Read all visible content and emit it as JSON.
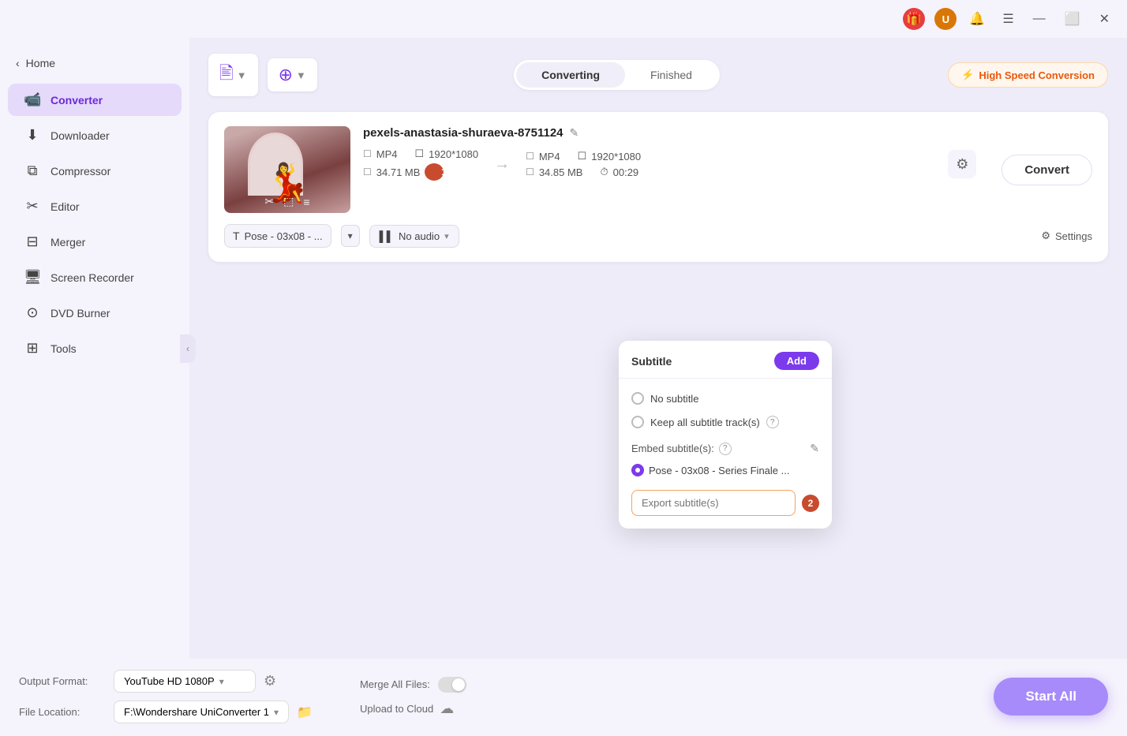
{
  "titlebar": {
    "gift_label": "🎁",
    "user_label": "U",
    "bell_label": "🔔",
    "menu_label": "☰",
    "minimize_label": "—",
    "maximize_label": "⬜",
    "close_label": "✕"
  },
  "sidebar": {
    "home_label": "Home",
    "back_label": "‹",
    "items": [
      {
        "id": "converter",
        "label": "Converter",
        "icon": "⊞"
      },
      {
        "id": "downloader",
        "label": "Downloader",
        "icon": "⬇"
      },
      {
        "id": "compressor",
        "label": "Compressor",
        "icon": "⧉"
      },
      {
        "id": "editor",
        "label": "Editor",
        "icon": "✂"
      },
      {
        "id": "merger",
        "label": "Merger",
        "icon": "⊟"
      },
      {
        "id": "screen-recorder",
        "label": "Screen Recorder",
        "icon": "⊡"
      },
      {
        "id": "dvd-burner",
        "label": "DVD Burner",
        "icon": "⊙"
      },
      {
        "id": "tools",
        "label": "Tools",
        "icon": "⊞"
      }
    ]
  },
  "tabs": {
    "converting": "Converting",
    "finished": "Finished"
  },
  "high_speed": {
    "icon": "⚡",
    "label": "High Speed Conversion"
  },
  "file": {
    "name": "pexels-anastasia-shuraeva-8751124",
    "input": {
      "format": "MP4",
      "resolution": "1920*1080",
      "size": "34.71 MB",
      "badge": "1"
    },
    "output": {
      "format": "MP4",
      "resolution": "1920*1080",
      "size": "34.85 MB",
      "duration": "00:29"
    },
    "convert_label": "Convert"
  },
  "subtitle_bar": {
    "subtitle_text": "Pose - 03x08 - ...",
    "audio_text": "No audio",
    "settings_label": "Settings"
  },
  "dropdown": {
    "title": "Subtitle",
    "add_label": "Add",
    "options": [
      {
        "id": "no-subtitle",
        "label": "No subtitle",
        "checked": false
      },
      {
        "id": "keep-all",
        "label": "Keep all subtitle track(s)",
        "checked": false
      }
    ],
    "embed_section_label": "Embed subtitle(s):",
    "embed_item": "Pose - 03x08 - Series Finale ...",
    "export_placeholder": "Export subtitle(s)",
    "export_badge": "2"
  },
  "bottom": {
    "output_format_label": "Output Format:",
    "output_format_value": "YouTube HD 1080P",
    "file_location_label": "File Location:",
    "file_location_value": "F:\\Wondershare UniConverter 1",
    "merge_label": "Merge All Files:",
    "upload_label": "Upload to Cloud",
    "start_all_label": "Start All"
  }
}
